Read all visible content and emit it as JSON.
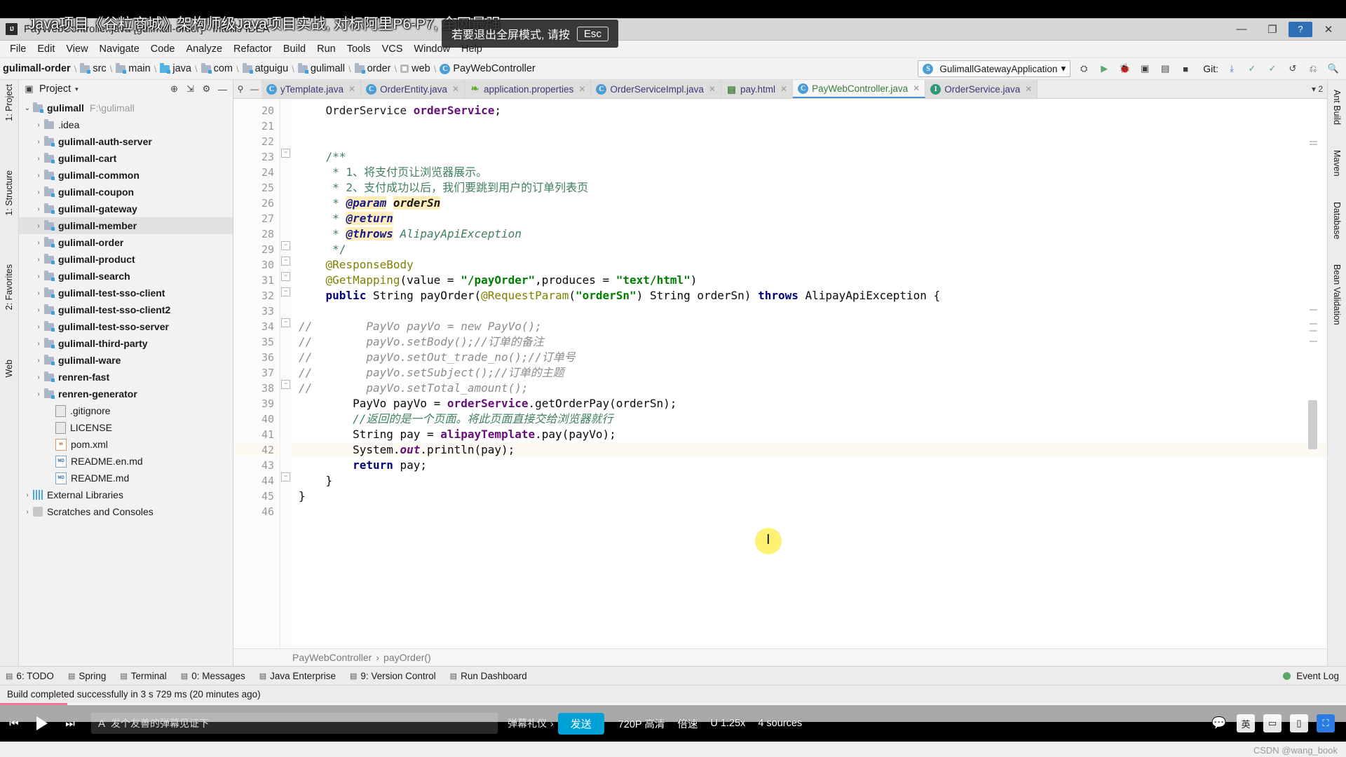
{
  "window": {
    "title": "PayWebController.java [gulimall-order] - IntelliJ IDEA",
    "logo": "IJ",
    "minimize": "—",
    "maximize": "❐",
    "close": "✕",
    "help_badge": "?"
  },
  "burned_overlay": {
    "course_title": "Java项目《谷粒商城》架构师级Java项目实战, 对标阿里P6-P7, 全网最强",
    "exit_fullscreen_hint": "若要退出全屏模式, 请按",
    "exit_key": "Esc",
    "watermark": "CSDN @wang_book"
  },
  "menubar": {
    "items": [
      "File",
      "Edit",
      "View",
      "Navigate",
      "Code",
      "Analyze",
      "Refactor",
      "Build",
      "Run",
      "Tools",
      "VCS",
      "Window",
      "Help"
    ]
  },
  "breadcrumb": {
    "module": "gulimall-order",
    "items": [
      {
        "label": "src",
        "icon": "folder-icon"
      },
      {
        "label": "main",
        "icon": "folder-icon"
      },
      {
        "label": "java",
        "icon": "folder-blue-icon"
      },
      {
        "label": "com",
        "icon": "folder-icon"
      },
      {
        "label": "atguigu",
        "icon": "folder-icon"
      },
      {
        "label": "gulimall",
        "icon": "folder-icon"
      },
      {
        "label": "order",
        "icon": "folder-icon"
      },
      {
        "label": "web",
        "icon": "package-icon"
      },
      {
        "label": "PayWebController",
        "icon": "class-icon"
      }
    ]
  },
  "toolbar": {
    "run_config": "GulimallGatewayApplication",
    "run_config_caret": "▾",
    "icons": [
      "build-icon",
      "run-icon",
      "debug-icon",
      "coverage-icon",
      "profile-icon",
      "stop-icon"
    ],
    "git_label": "Git:",
    "git_icons": [
      "update-project-icon",
      "commit-icon",
      "push-icon",
      "history-icon",
      "rollback-icon"
    ]
  },
  "project_panel": {
    "title": "Project",
    "caret": "▾",
    "icons": [
      "locate-icon",
      "collapse-all-icon",
      "settings-icon",
      "hide-icon"
    ],
    "tree": [
      {
        "label": "gulimall",
        "path": "F:\\gulimall",
        "arrow": "⌄",
        "icon": "module-folder-icon",
        "depth": 0,
        "bold": true,
        "selected": false
      },
      {
        "label": ".idea",
        "path": "",
        "arrow": "›",
        "icon": "folder-icon",
        "depth": 1,
        "bold": false,
        "selected": false
      },
      {
        "label": "gulimall-auth-server",
        "path": "",
        "arrow": "›",
        "icon": "module-folder-icon",
        "depth": 1,
        "bold": true,
        "selected": false
      },
      {
        "label": "gulimall-cart",
        "path": "",
        "arrow": "›",
        "icon": "module-folder-icon",
        "depth": 1,
        "bold": true,
        "selected": false
      },
      {
        "label": "gulimall-common",
        "path": "",
        "arrow": "›",
        "icon": "module-folder-icon",
        "depth": 1,
        "bold": true,
        "selected": false
      },
      {
        "label": "gulimall-coupon",
        "path": "",
        "arrow": "›",
        "icon": "module-folder-icon",
        "depth": 1,
        "bold": true,
        "selected": false
      },
      {
        "label": "gulimall-gateway",
        "path": "",
        "arrow": "›",
        "icon": "module-folder-icon",
        "depth": 1,
        "bold": true,
        "selected": false
      },
      {
        "label": "gulimall-member",
        "path": "",
        "arrow": "›",
        "icon": "module-folder-icon",
        "depth": 1,
        "bold": true,
        "selected": true
      },
      {
        "label": "gulimall-order",
        "path": "",
        "arrow": "›",
        "icon": "module-folder-icon",
        "depth": 1,
        "bold": true,
        "selected": false
      },
      {
        "label": "gulimall-product",
        "path": "",
        "arrow": "›",
        "icon": "module-folder-icon",
        "depth": 1,
        "bold": true,
        "selected": false
      },
      {
        "label": "gulimall-search",
        "path": "",
        "arrow": "›",
        "icon": "module-folder-icon",
        "depth": 1,
        "bold": true,
        "selected": false
      },
      {
        "label": "gulimall-test-sso-client",
        "path": "",
        "arrow": "›",
        "icon": "module-folder-icon",
        "depth": 1,
        "bold": true,
        "selected": false
      },
      {
        "label": "gulimall-test-sso-client2",
        "path": "",
        "arrow": "›",
        "icon": "module-folder-icon",
        "depth": 1,
        "bold": true,
        "selected": false
      },
      {
        "label": "gulimall-test-sso-server",
        "path": "",
        "arrow": "›",
        "icon": "module-folder-icon",
        "depth": 1,
        "bold": true,
        "selected": false
      },
      {
        "label": "gulimall-third-party",
        "path": "",
        "arrow": "›",
        "icon": "module-folder-icon",
        "depth": 1,
        "bold": true,
        "selected": false
      },
      {
        "label": "gulimall-ware",
        "path": "",
        "arrow": "›",
        "icon": "module-folder-icon",
        "depth": 1,
        "bold": true,
        "selected": false
      },
      {
        "label": "renren-fast",
        "path": "",
        "arrow": "›",
        "icon": "module-folder-icon",
        "depth": 1,
        "bold": true,
        "selected": false
      },
      {
        "label": "renren-generator",
        "path": "",
        "arrow": "›",
        "icon": "module-folder-icon",
        "depth": 1,
        "bold": true,
        "selected": false
      },
      {
        "label": ".gitignore",
        "path": "",
        "arrow": "",
        "icon": "file-icon",
        "depth": 2,
        "bold": false,
        "selected": false
      },
      {
        "label": "LICENSE",
        "path": "",
        "arrow": "",
        "icon": "file-icon",
        "depth": 2,
        "bold": false,
        "selected": false
      },
      {
        "label": "pom.xml",
        "path": "",
        "arrow": "",
        "icon": "maven-icon",
        "depth": 2,
        "bold": false,
        "selected": false
      },
      {
        "label": "README.en.md",
        "path": "",
        "arrow": "",
        "icon": "markdown-icon",
        "depth": 2,
        "bold": false,
        "selected": false
      },
      {
        "label": "README.md",
        "path": "",
        "arrow": "",
        "icon": "markdown-icon",
        "depth": 2,
        "bold": false,
        "selected": false
      },
      {
        "label": "External Libraries",
        "path": "",
        "arrow": "›",
        "icon": "library-icon",
        "depth": 0,
        "bold": false,
        "selected": false
      },
      {
        "label": "Scratches and Consoles",
        "path": "",
        "arrow": "›",
        "icon": "scratch-icon",
        "depth": 0,
        "bold": false,
        "selected": false
      }
    ]
  },
  "left_strip": {
    "items": [
      "1: Project",
      "1: Structure",
      "2: Favorites",
      "Web"
    ]
  },
  "right_strip": {
    "items": [
      "Ant Build",
      "Maven",
      "Database",
      "Bean Validation"
    ]
  },
  "editor_tabs": [
    {
      "label": "yTemplate.java",
      "icon": "class-icon",
      "active": false,
      "close": "✕"
    },
    {
      "label": "OrderEntity.java",
      "icon": "class-icon",
      "active": false,
      "close": "✕"
    },
    {
      "label": "application.properties",
      "icon": "spring-leaf-icon",
      "active": false,
      "close": "✕"
    },
    {
      "label": "OrderServiceImpl.java",
      "icon": "class-icon",
      "active": false,
      "close": "✕"
    },
    {
      "label": "pay.html",
      "icon": "html-icon",
      "active": false,
      "close": "✕"
    },
    {
      "label": "PayWebController.java",
      "icon": "class-icon",
      "active": true,
      "close": "✕"
    },
    {
      "label": "OrderService.java",
      "icon": "interface-icon",
      "active": false,
      "close": "✕"
    }
  ],
  "editor_tabs_overflow": "▾ 2",
  "code": {
    "first_line": 20,
    "current_line": 42,
    "lines": [
      {
        "n": 20,
        "segments": [
          {
            "t": "    ",
            "c": ""
          },
          {
            "t": "OrderService",
            "c": "mth"
          },
          {
            "t": " ",
            "c": ""
          },
          {
            "t": "orderService",
            "c": "fld"
          },
          {
            "t": ";",
            "c": ""
          }
        ],
        "gutter_icon": "bean-icon"
      },
      {
        "n": 21,
        "segments": []
      },
      {
        "n": 22,
        "segments": []
      },
      {
        "n": 23,
        "segments": [
          {
            "t": "    /**",
            "c": "jd"
          }
        ],
        "fold": "−"
      },
      {
        "n": 24,
        "segments": [
          {
            "t": "     * 1、将支付页让浏览器展示。",
            "c": "jd"
          }
        ]
      },
      {
        "n": 25,
        "segments": [
          {
            "t": "     * 2、支付成功以后，我们要跳到用户的订单列表页",
            "c": "jd"
          }
        ]
      },
      {
        "n": 26,
        "segments": [
          {
            "t": "     * ",
            "c": "jd"
          },
          {
            "t": "@param",
            "c": "jdtag"
          },
          {
            "t": " ",
            "c": ""
          },
          {
            "t": "orderSn",
            "c": "jdp"
          }
        ]
      },
      {
        "n": 27,
        "segments": [
          {
            "t": "     * ",
            "c": "jd"
          },
          {
            "t": "@return",
            "c": "jdtag"
          }
        ]
      },
      {
        "n": 28,
        "segments": [
          {
            "t": "     * ",
            "c": "jd"
          },
          {
            "t": "@throws",
            "c": "jdtag"
          },
          {
            "t": " ",
            "c": ""
          },
          {
            "t": "AlipayApiException",
            "c": "jdp2"
          }
        ]
      },
      {
        "n": 29,
        "segments": [
          {
            "t": "     */",
            "c": "jd"
          }
        ],
        "fold": "−"
      },
      {
        "n": 30,
        "segments": [
          {
            "t": "    ",
            "c": ""
          },
          {
            "t": "@ResponseBody",
            "c": "ann"
          }
        ],
        "fold": "−"
      },
      {
        "n": 31,
        "segments": [
          {
            "t": "    ",
            "c": ""
          },
          {
            "t": "@GetMapping",
            "c": "ann"
          },
          {
            "t": "(value = ",
            "c": ""
          },
          {
            "t": "\"/payOrder\"",
            "c": "str"
          },
          {
            "t": ",produces = ",
            "c": ""
          },
          {
            "t": "\"text/html\"",
            "c": "str"
          },
          {
            "t": ")",
            "c": ""
          }
        ],
        "fold": "−"
      },
      {
        "n": 32,
        "segments": [
          {
            "t": "    ",
            "c": ""
          },
          {
            "t": "public",
            "c": "kw"
          },
          {
            "t": " String payOrder(",
            "c": ""
          },
          {
            "t": "@RequestParam",
            "c": "ann"
          },
          {
            "t": "(",
            "c": ""
          },
          {
            "t": "\"orderSn\"",
            "c": "str"
          },
          {
            "t": ") String orderSn) ",
            "c": ""
          },
          {
            "t": "throws",
            "c": "kw"
          },
          {
            "t": " AlipayApiException {",
            "c": ""
          }
        ],
        "fold": "−"
      },
      {
        "n": 33,
        "segments": []
      },
      {
        "n": 34,
        "segments": [
          {
            "t": "//",
            "c": "cmtline"
          },
          {
            "t": "        PayVo payVo = new PayVo();",
            "c": "cmtline"
          }
        ],
        "fold": "−",
        "comment_col": true
      },
      {
        "n": 35,
        "segments": [
          {
            "t": "//",
            "c": "cmtline"
          },
          {
            "t": "        payVo.setBody();//订单的备注",
            "c": "cmtline"
          }
        ],
        "comment_col": true
      },
      {
        "n": 36,
        "segments": [
          {
            "t": "//",
            "c": "cmtline"
          },
          {
            "t": "        payVo.setOut_trade_no();//订单号",
            "c": "cmtline"
          }
        ],
        "comment_col": true
      },
      {
        "n": 37,
        "segments": [
          {
            "t": "//",
            "c": "cmtline"
          },
          {
            "t": "        payVo.setSubject();//订单的主题",
            "c": "cmtline"
          }
        ],
        "comment_col": true
      },
      {
        "n": 38,
        "segments": [
          {
            "t": "//",
            "c": "cmtline"
          },
          {
            "t": "        payVo.setTotal_amount();",
            "c": "cmtline"
          }
        ],
        "fold": "−",
        "comment_col": true
      },
      {
        "n": 39,
        "segments": [
          {
            "t": "        PayVo payVo = ",
            "c": ""
          },
          {
            "t": "orderService",
            "c": "fld"
          },
          {
            "t": ".getOrderPay(orderSn);",
            "c": ""
          }
        ]
      },
      {
        "n": 40,
        "segments": [
          {
            "t": "        //返回的是一个页面。将此页面直接交给浏览器就行",
            "c": "cmt"
          }
        ]
      },
      {
        "n": 41,
        "segments": [
          {
            "t": "        String pay = ",
            "c": ""
          },
          {
            "t": "alipayTemplate",
            "c": "fld"
          },
          {
            "t": ".pay(payVo);",
            "c": ""
          }
        ]
      },
      {
        "n": 42,
        "segments": [
          {
            "t": "        System.",
            "c": ""
          },
          {
            "t": "out",
            "c": "fld-i"
          },
          {
            "t": ".println(pay);",
            "c": ""
          }
        ],
        "current": true
      },
      {
        "n": 43,
        "segments": [
          {
            "t": "        ",
            "c": ""
          },
          {
            "t": "return",
            "c": "kw"
          },
          {
            "t": " pay;",
            "c": ""
          }
        ]
      },
      {
        "n": 44,
        "segments": [
          {
            "t": "    }",
            "c": ""
          }
        ],
        "fold": "−"
      },
      {
        "n": 45,
        "segments": [
          {
            "t": "}",
            "c": ""
          }
        ]
      },
      {
        "n": 46,
        "segments": []
      }
    ]
  },
  "editor_breadcrumb": {
    "class": "PayWebController",
    "method": "payOrder()",
    "sep": "›"
  },
  "bottom_toolwindows": [
    {
      "label": "6: TODO",
      "icon": "todo-icon"
    },
    {
      "label": "Spring",
      "icon": "spring-icon"
    },
    {
      "label": "Terminal",
      "icon": "terminal-icon"
    },
    {
      "label": "0: Messages",
      "icon": "messages-icon"
    },
    {
      "label": "Java Enterprise",
      "icon": "java-ee-icon"
    },
    {
      "label": "9: Version Control",
      "icon": "version-control-icon"
    },
    {
      "label": "Run Dashboard",
      "icon": "run-dashboard-icon"
    }
  ],
  "event_log": {
    "label": "Event Log",
    "icon": "event-log-icon"
  },
  "status_bar": {
    "message": "Build completed successfully in 3 s 729 ms (20 minutes ago)"
  },
  "player": {
    "play_icon": "play-icon",
    "prev_icon": "prev-icon",
    "next_icon": "next-icon",
    "danmu_placeholder": "发个友善的弹幕见证下",
    "danmu_icon": "danmu-a-icon",
    "etiquette": "弹幕礼仪",
    "etiquette_caret": "›",
    "send": "发送",
    "quality": "720P 高清",
    "speed": "倍速",
    "episode": "U 1.25x",
    "sources": "4 sources",
    "right_icons": [
      "subtitle-icon",
      "ime-cn-icon",
      "pip-icon",
      "wide-icon",
      "fullscreen-icon"
    ],
    "right_labels": [
      "英"
    ]
  },
  "colors": {
    "accent": "#2c7be5",
    "bilibili_pink": "#fb7299",
    "bilibili_blue": "#00a1d6",
    "keyword": "#000080",
    "string": "#008000",
    "comment": "#3f7f5f",
    "annotation": "#808000",
    "field": "#660e7a"
  }
}
